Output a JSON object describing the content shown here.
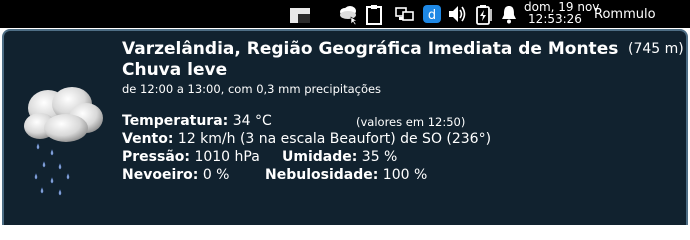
{
  "taskbar": {
    "icons": [
      "window-icon",
      "weather-cloud-icon",
      "clipboard-icon",
      "network-icon",
      "app-d-icon",
      "volume-icon",
      "battery-icon",
      "bell-icon"
    ],
    "clock": {
      "date": "dom, 19 nov",
      "time": "12:53:26"
    },
    "user": "Rommulo"
  },
  "weather": {
    "location": "Varzelândia, Região Geográfica Imediata de Montes",
    "elevation": "(745 m)",
    "condition": "Chuva leve",
    "precipitation": "de 12:00 a 13:00, com 0,3 mm precipitações",
    "temperature": {
      "label": "Temperatura:",
      "value": "34 °C",
      "note": "(valores em 12:50)"
    },
    "wind": {
      "label": "Vento:",
      "value": "12 km/h (3  na escala Beaufort) de SO (236°)"
    },
    "pressure": {
      "label": "Pressão:",
      "value": "1010 hPa"
    },
    "humidity": {
      "label": "Umidade:",
      "value": "35 %"
    },
    "fog": {
      "label": "Nevoeiro:",
      "value": "0 %"
    },
    "cloudiness": {
      "label": "Nebulosidade:",
      "value": "100 %"
    }
  },
  "colors": {
    "taskbar_bg": "#000000",
    "popup_bg": "#11222f",
    "popup_border": "#4e6e85",
    "text": "#ffffff"
  }
}
